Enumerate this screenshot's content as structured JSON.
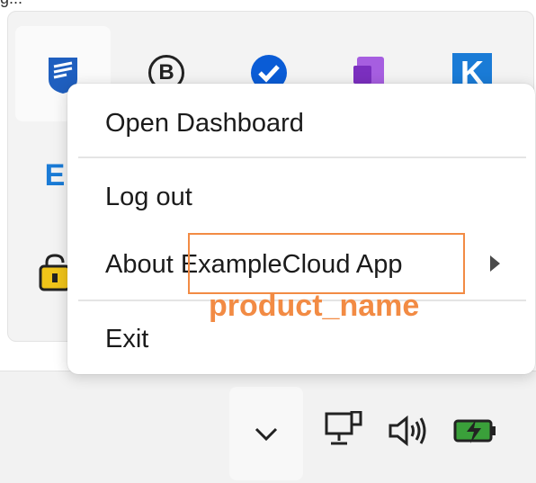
{
  "header": {
    "caption": "g..."
  },
  "tray_icons": [
    {
      "name": "examplecloud-app-icon",
      "color": "#1f5fbf"
    },
    {
      "name": "bold-b-icon",
      "text": "B"
    },
    {
      "name": "checkmark-circle-icon",
      "color": "#0a5cd6"
    },
    {
      "name": "onenote-icon",
      "color": "#7b2fbf"
    },
    {
      "name": "k-app-icon",
      "text": "K",
      "color": "#1a7bd6"
    },
    {
      "name": "e-app-icon",
      "text": "E"
    },
    {
      "name": "lock-icon"
    }
  ],
  "context_menu": {
    "items": [
      {
        "id": "open-dashboard",
        "label": "Open Dashboard"
      },
      {
        "id": "log-out",
        "label": "Log out"
      },
      {
        "id": "about",
        "label": "About ExampleCloud App",
        "has_submenu": true
      },
      {
        "id": "exit",
        "label": "Exit"
      }
    ]
  },
  "annotation": {
    "label": "product_name",
    "color": "#f28b44"
  },
  "taskbar": {
    "icons": [
      "chevron-up-icon",
      "network-icon",
      "speaker-icon",
      "battery-charging-icon"
    ],
    "battery_color": "#3aa03a"
  }
}
